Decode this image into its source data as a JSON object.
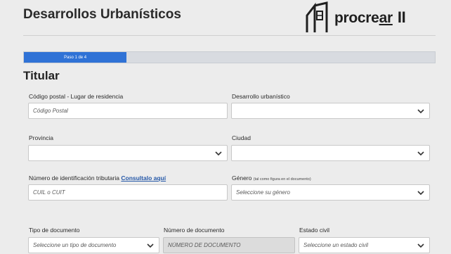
{
  "header": {
    "title": "Desarrollos Urbanísticos"
  },
  "logo": {
    "word_plain": "procre",
    "word_underlined": "ar",
    "roman": "II"
  },
  "progress": {
    "label": "Paso 1 de 4",
    "fraction": 0.25,
    "color": "#2f72d6"
  },
  "section": {
    "title": "Titular"
  },
  "form": {
    "codigo_postal": {
      "label": "Código postal - Lugar de residencia",
      "placeholder": "Código Postal"
    },
    "desarrollo": {
      "label": "Desarrollo urbanístico",
      "value": ""
    },
    "provincia": {
      "label": "Provincia",
      "value": ""
    },
    "ciudad": {
      "label": "Ciudad",
      "value": ""
    },
    "cuit": {
      "label": "Número de identificación tributaria",
      "link": "Consultalo aquí",
      "placeholder": "CUIL o CUIT"
    },
    "genero": {
      "label": "Género",
      "note": "(tal como figura en el documento)",
      "value": "Seleccione su género"
    },
    "tipo_doc": {
      "label": "Tipo de documento",
      "value": "Seleccione un tipo de documento"
    },
    "num_doc": {
      "label": "Número de documento",
      "placeholder": "NÚMERO DE DOCUMENTO"
    },
    "estado_civil": {
      "label": "Estado civil",
      "value": "Seleccione un estado civil"
    }
  },
  "icons": {
    "select_caret": "chevron-down-icon",
    "logo_mark": "house-outline-icon"
  }
}
